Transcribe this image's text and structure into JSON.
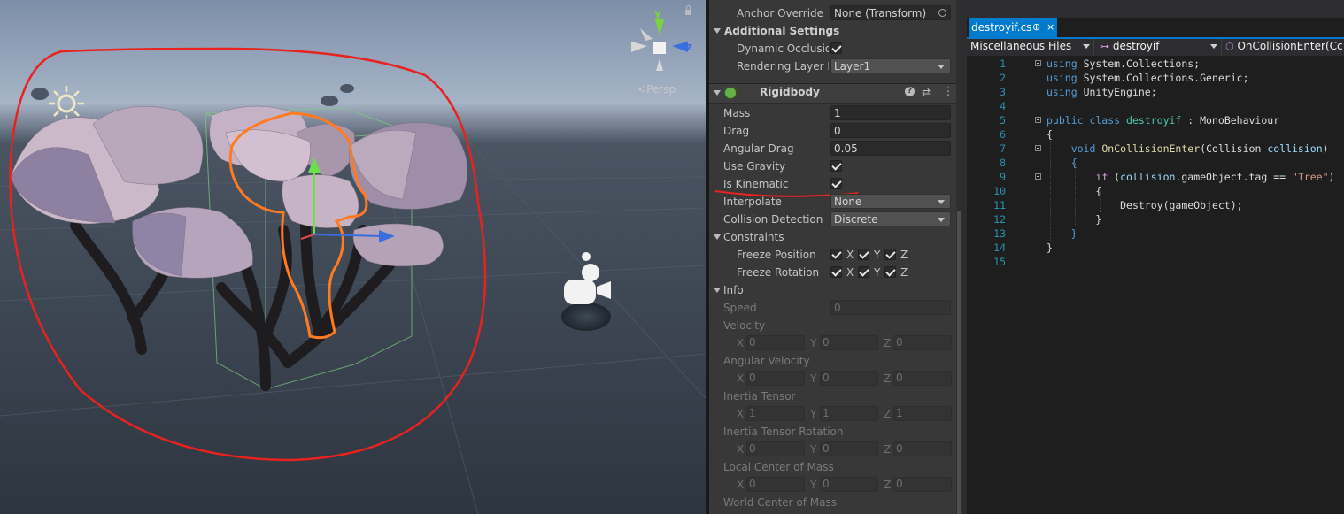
{
  "scene": {
    "persp_label": "Persp",
    "axis_y": "y",
    "axis_z": "z"
  },
  "inspector": {
    "anchor_override": {
      "label": "Anchor Override",
      "value": "None (Transform)"
    },
    "additional_settings": "Additional Settings",
    "dynamic_occlusion": {
      "label": "Dynamic Occlusion",
      "checked": true
    },
    "rendering_layer": {
      "label": "Rendering Layer Mask",
      "value": "Layer1"
    },
    "rigidbody": {
      "title": "Rigidbody",
      "mass": {
        "label": "Mass",
        "value": "1"
      },
      "drag": {
        "label": "Drag",
        "value": "0"
      },
      "angular_drag": {
        "label": "Angular Drag",
        "value": "0.05"
      },
      "use_gravity": {
        "label": "Use Gravity",
        "checked": true
      },
      "is_kinematic": {
        "label": "Is Kinematic",
        "checked": true
      },
      "interpolate": {
        "label": "Interpolate",
        "value": "None"
      },
      "collision_detection": {
        "label": "Collision Detection",
        "value": "Discrete"
      },
      "constraints": "Constraints",
      "freeze_position": {
        "label": "Freeze Position"
      },
      "freeze_rotation": {
        "label": "Freeze Rotation"
      },
      "axis_x": "X",
      "axis_y": "Y",
      "axis_z": "Z",
      "info": "Info",
      "speed": {
        "label": "Speed",
        "value": "0"
      },
      "velocity": {
        "label": "Velocity",
        "x": "0",
        "y": "0",
        "z": "0"
      },
      "angular_velocity": {
        "label": "Angular Velocity",
        "x": "0",
        "y": "0",
        "z": "0"
      },
      "inertia_tensor": {
        "label": "Inertia Tensor",
        "x": "1",
        "y": "1",
        "z": "1"
      },
      "inertia_tensor_rotation": {
        "label": "Inertia Tensor Rotation",
        "x": "0",
        "y": "0",
        "z": "0"
      },
      "local_center_of_mass": {
        "label": "Local Center of Mass",
        "x": "0",
        "y": "0",
        "z": "0"
      },
      "world_center_of_mass": {
        "label": "World Center of Mass"
      }
    }
  },
  "editor": {
    "tab_name": "destroyif.cs",
    "tab_pin": "⊕",
    "tab_close": "×",
    "nav_project": "Miscellaneous Files",
    "nav_class": "destroyif",
    "nav_member": "OnCollisionEnter(Cc",
    "line_numbers": [
      "1",
      "2",
      "3",
      "4",
      "5",
      "6",
      "7",
      "8",
      "9",
      "10",
      "11",
      "12",
      "13",
      "14",
      "15"
    ],
    "code": {
      "l1": "System.Collections;",
      "l2": "System.Collections.Generic;",
      "l3": "UnityEngine;",
      "class_name": "destroyif",
      "base_class": "MonoBehaviour",
      "method": "OnCollisionEnter",
      "param_type": "Collision",
      "param_name": "collision",
      "cond_obj": "collision",
      "cond_member": ".gameObject.tag == ",
      "cond_str": "\"Tree\"",
      "destroy_call": "Destroy",
      "destroy_arg": "(gameObject);"
    }
  }
}
